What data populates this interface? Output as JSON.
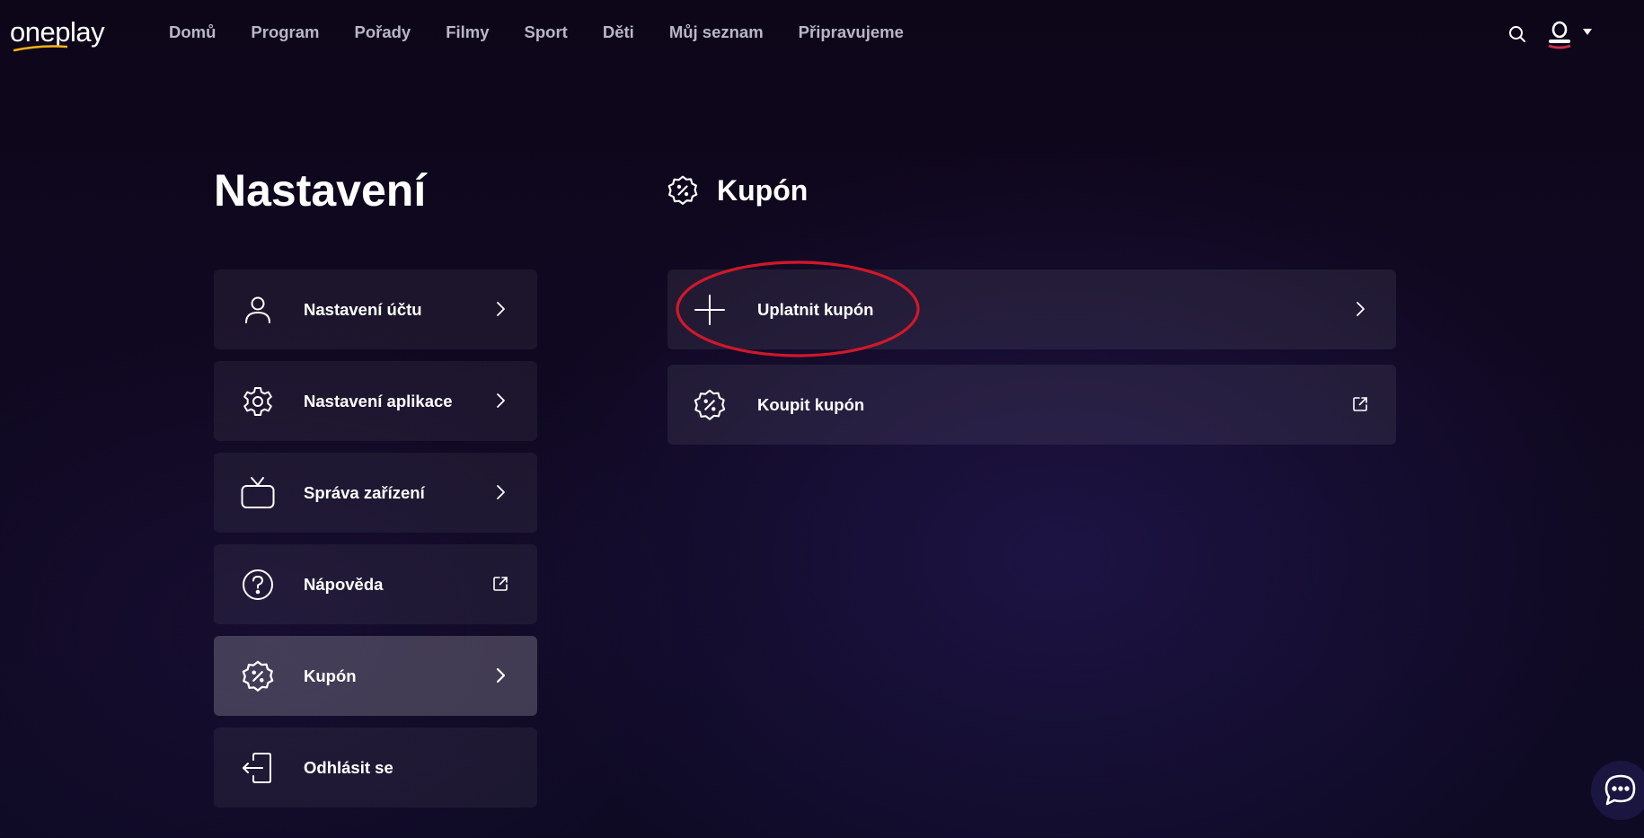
{
  "app": {
    "logo_text": "oneplay"
  },
  "nav": {
    "items": [
      "Domů",
      "Program",
      "Pořady",
      "Filmy",
      "Sport",
      "Děti",
      "Můj seznam",
      "Připravujeme"
    ]
  },
  "page": {
    "title": "Nastavení"
  },
  "sidebar": {
    "items": [
      {
        "label": "Nastavení účtu",
        "icon": "user-icon",
        "trail": "chevron-right-icon"
      },
      {
        "label": "Nastavení aplikace",
        "icon": "gear-icon",
        "trail": "chevron-right-icon"
      },
      {
        "label": "Správa zařízení",
        "icon": "tv-icon",
        "trail": "chevron-right-icon"
      },
      {
        "label": "Nápověda",
        "icon": "help-icon",
        "trail": "external-link-icon"
      },
      {
        "label": "Kupón",
        "icon": "coupon-icon",
        "trail": "chevron-right-icon",
        "active": true
      },
      {
        "label": "Odhlásit se",
        "icon": "logout-icon",
        "trail": ""
      }
    ]
  },
  "section": {
    "title": "Kupón",
    "icon": "coupon-icon",
    "cards": [
      {
        "label": "Uplatnit kupón",
        "icon": "plus-icon",
        "trail": "chevron-right-icon",
        "highlighted": true
      },
      {
        "label": "Koupit kupón",
        "icon": "coupon-icon",
        "trail": "external-link-icon"
      }
    ]
  },
  "colors": {
    "background": "#0e0a24",
    "nav_text": "#b9b6c6",
    "card_bg": "rgba(255,255,255,0.07)",
    "active_bg": "rgba(255,255,255,0.20)",
    "highlight_ring": "#d0182a",
    "logo_swoosh": "#f5b21a"
  }
}
